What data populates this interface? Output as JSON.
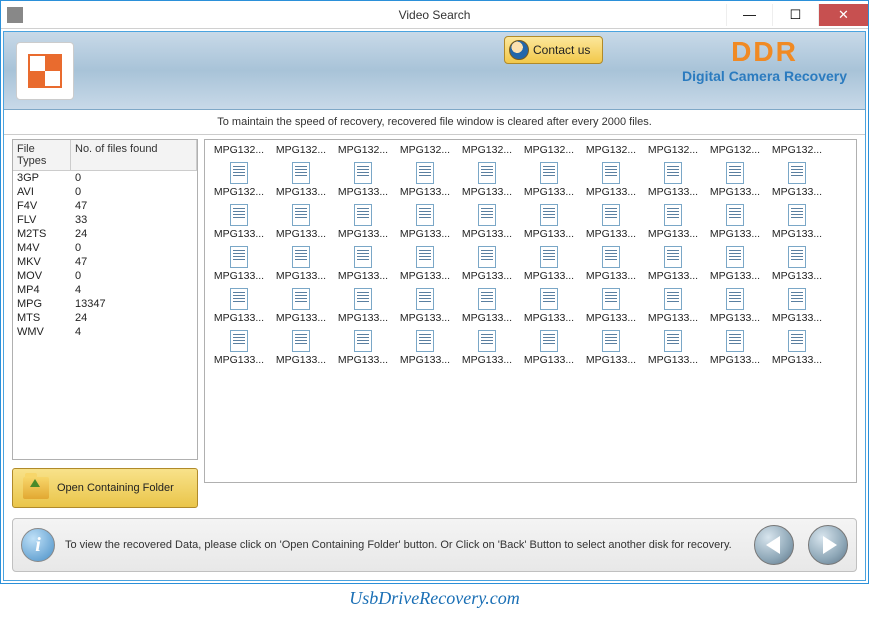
{
  "window": {
    "title": "Video Search"
  },
  "banner": {
    "contact_label": "Contact us",
    "brand_top": "DDR",
    "brand_sub": "Digital Camera Recovery"
  },
  "notice": "To maintain the speed of recovery, recovered file window is cleared after every 2000 files.",
  "filetypes": {
    "header_type": "File Types",
    "header_count": "No. of files found",
    "rows": [
      {
        "type": "3GP",
        "count": "0"
      },
      {
        "type": "AVI",
        "count": "0"
      },
      {
        "type": "F4V",
        "count": "47"
      },
      {
        "type": "FLV",
        "count": "33"
      },
      {
        "type": "M2TS",
        "count": "24"
      },
      {
        "type": "M4V",
        "count": "0"
      },
      {
        "type": "MKV",
        "count": "47"
      },
      {
        "type": "MOV",
        "count": "0"
      },
      {
        "type": "MP4",
        "count": "4"
      },
      {
        "type": "MPG",
        "count": "13347"
      },
      {
        "type": "MTS",
        "count": "24"
      },
      {
        "type": "WMV",
        "count": "4"
      }
    ]
  },
  "open_folder_label": "Open Containing Folder",
  "files": {
    "label_prefix": "MPG13",
    "row_top_labels": [
      "MPG132...",
      "MPG132...",
      "MPG132...",
      "MPG132...",
      "MPG132...",
      "MPG132...",
      "MPG132...",
      "MPG132...",
      "MPG132...",
      "MPG132..."
    ],
    "rows_full": [
      [
        "MPG132...",
        "MPG133...",
        "MPG133...",
        "MPG133...",
        "MPG133...",
        "MPG133...",
        "MPG133...",
        "MPG133...",
        "MPG133...",
        "MPG133..."
      ],
      [
        "MPG133...",
        "MPG133...",
        "MPG133...",
        "MPG133...",
        "MPG133...",
        "MPG133...",
        "MPG133...",
        "MPG133...",
        "MPG133...",
        "MPG133..."
      ],
      [
        "MPG133...",
        "MPG133...",
        "MPG133...",
        "MPG133...",
        "MPG133...",
        "MPG133...",
        "MPG133...",
        "MPG133...",
        "MPG133...",
        "MPG133..."
      ],
      [
        "MPG133...",
        "MPG133...",
        "MPG133...",
        "MPG133...",
        "MPG133...",
        "MPG133...",
        "MPG133...",
        "MPG133...",
        "MPG133...",
        "MPG133..."
      ],
      [
        "MPG133...",
        "MPG133...",
        "MPG133...",
        "MPG133...",
        "MPG133...",
        "MPG133...",
        "MPG133...",
        "MPG133...",
        "MPG133...",
        "MPG133..."
      ]
    ]
  },
  "footer": {
    "message": "To view the recovered Data, please click on 'Open Containing Folder' button. Or Click on 'Back' Button to select another disk for recovery."
  },
  "watermark": "UsbDriveRecovery.com"
}
